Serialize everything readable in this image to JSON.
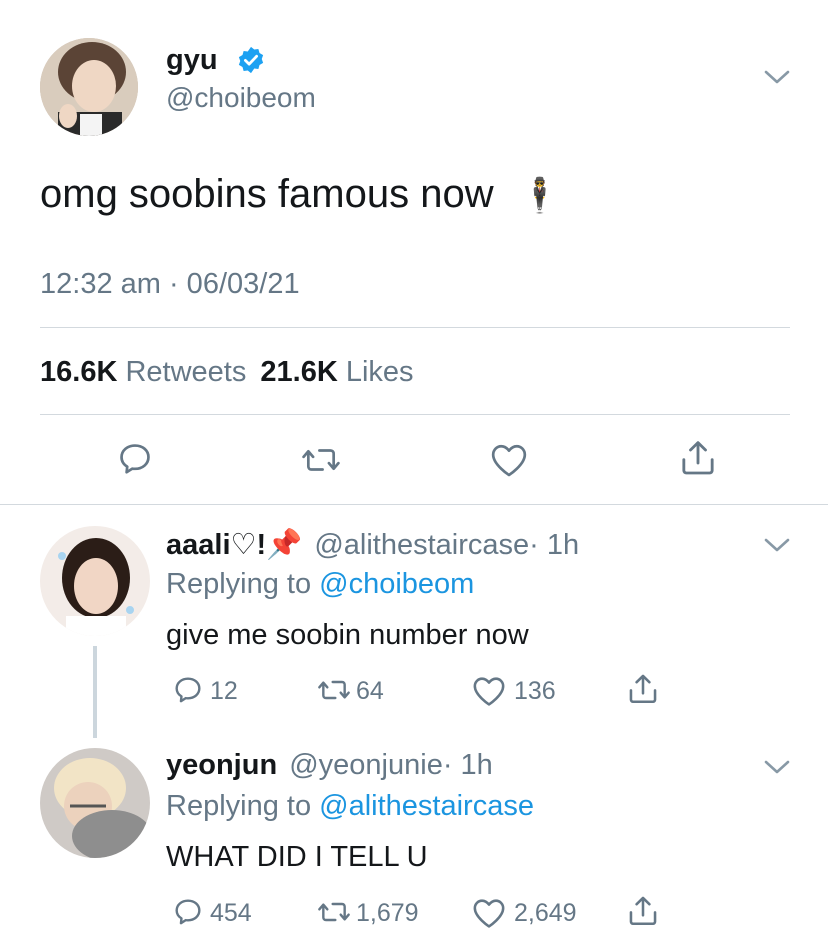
{
  "main_tweet": {
    "display_name": "gyu",
    "handle": "@choibeom",
    "text": "omg soobins famous now",
    "emoji": "🕴",
    "timestamp": "12:32 am · 06/03/21",
    "retweets_count": "16.6K",
    "retweets_label": "Retweets",
    "likes_count": "21.6K",
    "likes_label": "Likes"
  },
  "replies": [
    {
      "display_name": "aaali♡!📌",
      "handle": "@alithestaircase",
      "time": "· 1h",
      "replying_prefix": "Replying to",
      "replying_to": "@choibeom",
      "text": "give me soobin number now",
      "reply_count": "12",
      "retweet_count": "64",
      "like_count": "136"
    },
    {
      "display_name": "yeonjun",
      "handle": "@yeonjunie",
      "time": "· 1h",
      "replying_prefix": "Replying to",
      "replying_to": "@alithestaircase",
      "text": "WHAT DID I TELL U",
      "reply_count": "454",
      "retweet_count": "1,679",
      "like_count": "2,649"
    }
  ],
  "colors": {
    "text": "#14171a",
    "secondary": "#657786",
    "link": "#1b95e0",
    "verified": "#1da1f2",
    "divider": "#d3d9de"
  },
  "icons": [
    "verified-badge-icon",
    "chevron-down-icon",
    "reply-icon",
    "retweet-icon",
    "like-icon",
    "share-icon"
  ]
}
